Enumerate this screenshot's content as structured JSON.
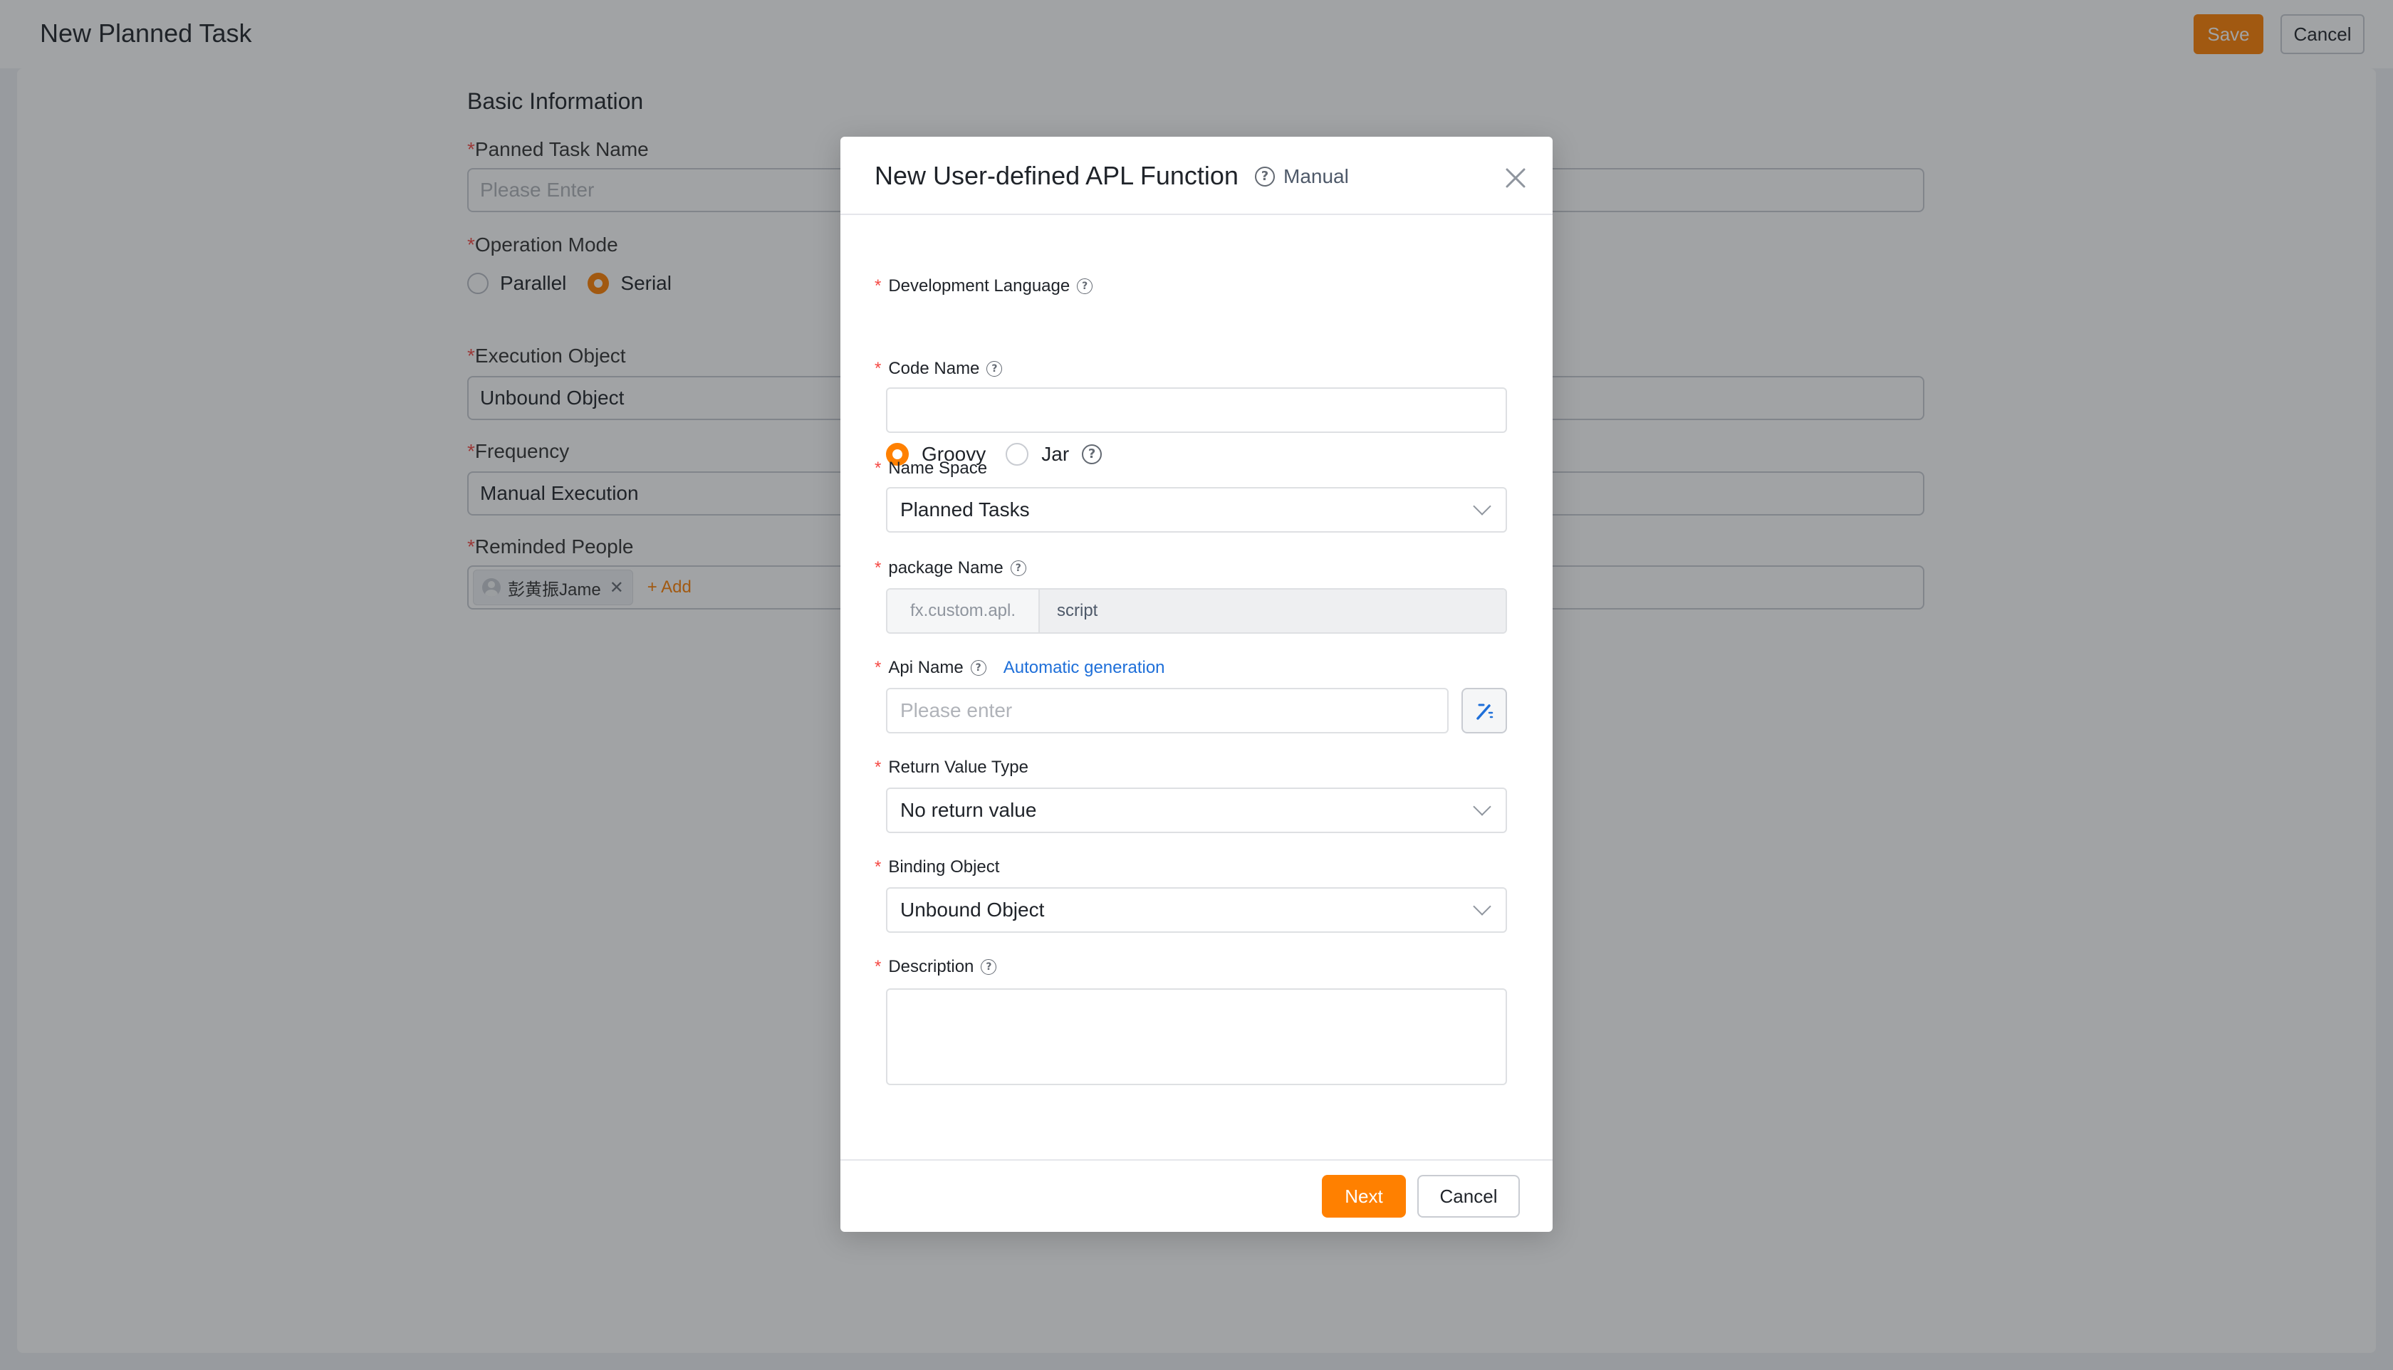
{
  "page": {
    "title": "New Planned Task",
    "save_label": "Save",
    "cancel_label": "Cancel",
    "section_title": "Basic Information",
    "fields": {
      "task_name": {
        "label": "Panned Task Name",
        "placeholder": "Please Enter"
      },
      "operation_mode": {
        "label": "Operation Mode",
        "options": [
          "Parallel",
          "Serial"
        ],
        "selected": "Serial"
      },
      "execution_object": {
        "label": "Execution Object",
        "value": "Unbound Object"
      },
      "frequency": {
        "label": "Frequency",
        "value": "Manual Execution"
      },
      "reminded_people": {
        "label": "Reminded People",
        "person": "彭黄振Jame",
        "add_label": "+ Add"
      }
    }
  },
  "modal": {
    "title": "New User-defined APL Function",
    "manual_label": "Manual",
    "development_language": {
      "label": "Development Language",
      "options": [
        "Groovy",
        "Jar"
      ],
      "selected": "Groovy"
    },
    "code_name": {
      "label": "Code Name",
      "value": ""
    },
    "name_space": {
      "label": "Name Space",
      "value": "Planned Tasks"
    },
    "package_name": {
      "label": "package Name",
      "prefix": "fx.custom.apl.",
      "value": "script"
    },
    "api_name": {
      "label": "Api Name",
      "auto_label": "Automatic generation",
      "placeholder": "Please enter"
    },
    "return_value_type": {
      "label": "Return Value Type",
      "value": "No return value"
    },
    "binding_object": {
      "label": "Binding Object",
      "value": "Unbound Object"
    },
    "description": {
      "label": "Description",
      "value": ""
    },
    "next_label": "Next",
    "cancel_label": "Cancel"
  },
  "colors": {
    "accent": "#ff8000",
    "link": "#1e6fd9",
    "required": "#f54a45"
  }
}
